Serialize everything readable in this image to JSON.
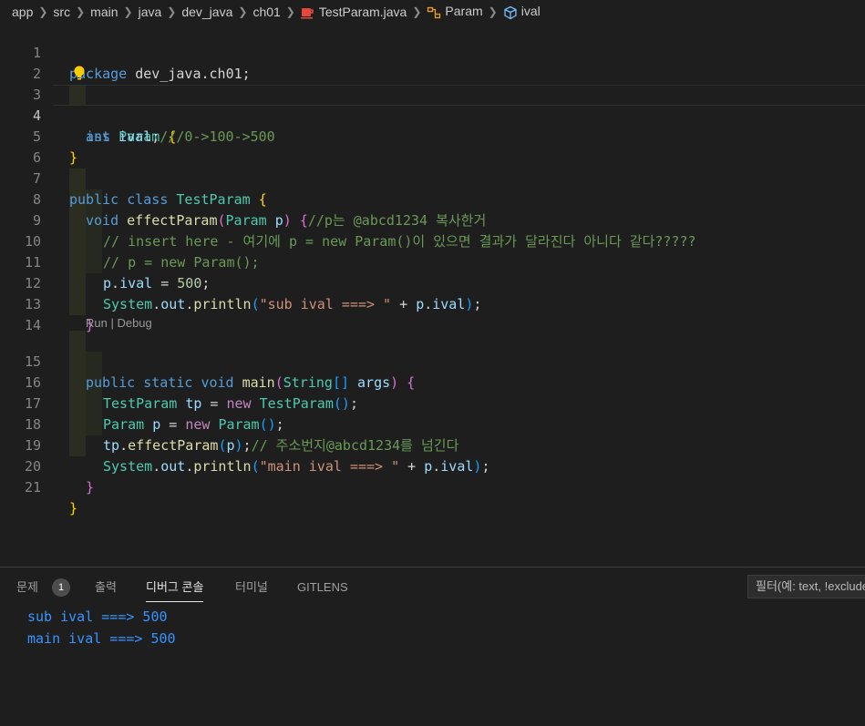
{
  "breadcrumb": {
    "items": [
      "app",
      "src",
      "main",
      "java",
      "dev_java",
      "ch01"
    ],
    "file": "TestParam.java",
    "class_symbol": "Param",
    "field_symbol": "ival"
  },
  "editor": {
    "line_numbers": [
      "1",
      "2",
      "3",
      "4",
      "5",
      "6",
      "7",
      "8",
      "9",
      "10",
      "11",
      "12",
      "13",
      "14",
      "15",
      "16",
      "17",
      "18",
      "19",
      "20",
      "21"
    ],
    "active_line": "4",
    "codelens": "Run | Debug",
    "lines": {
      "l1": [
        "package",
        " dev_java.ch01;"
      ],
      "l3": [
        "ass",
        " ",
        "Param",
        " ",
        "{"
      ],
      "l4": [
        "int",
        " ",
        "ival",
        ";",
        "///0->100->500"
      ],
      "l5": [
        "}"
      ],
      "l7": [
        "public",
        " ",
        "class",
        " ",
        "TestParam",
        " ",
        "{"
      ],
      "l8": [
        "void",
        " ",
        "effectParam",
        "(",
        "Param",
        " ",
        "p",
        ")",
        " ",
        "{",
        "//p는 @abcd1234 복사한거"
      ],
      "l9": [
        "// insert here - 여기에 p = new Param()이 있으면 결과가 달라진다 아니다 같다?????"
      ],
      "l10": [
        "// p = new Param();"
      ],
      "l11": [
        "p",
        ".",
        "ival",
        " = ",
        "500",
        ";"
      ],
      "l12": [
        "System",
        ".",
        "out",
        ".",
        "println",
        "(",
        "\"sub ival ===> \"",
        " + ",
        "p",
        ".",
        "ival",
        ")",
        ";"
      ],
      "l13": [
        "}"
      ],
      "l15": [
        "public",
        " ",
        "static",
        " ",
        "void",
        " ",
        "main",
        "(",
        "String",
        "[]",
        " ",
        "args",
        ")",
        " ",
        "{"
      ],
      "l16": [
        "TestParam",
        " ",
        "tp",
        " = ",
        "new",
        " ",
        "TestParam",
        "()",
        ";"
      ],
      "l17": [
        "Param",
        " ",
        "p",
        " = ",
        "new",
        " ",
        "Param",
        "()",
        ";"
      ],
      "l18": [
        "tp",
        ".",
        "effectParam",
        "(",
        "p",
        ")",
        ";",
        "// 주소번지@abcd1234를 넘긴다"
      ],
      "l19": [
        "System",
        ".",
        "out",
        ".",
        "println",
        "(",
        "\"main ival ===> \"",
        " + ",
        "p",
        ".",
        "ival",
        ")",
        ";"
      ],
      "l20": [
        "}"
      ],
      "l21": [
        "}"
      ]
    }
  },
  "panel": {
    "tabs": {
      "problems": "문제",
      "problems_count": "1",
      "output": "출력",
      "debug_console": "디버그 콘솔",
      "terminal": "터미널",
      "gitlens": "GITLENS"
    },
    "filter_placeholder": "필터(예: text, !exclude)",
    "console_lines": [
      "sub ival ===> 500",
      "main ival ===> 500"
    ]
  },
  "colors": {
    "background": "#1e1e1e",
    "keyword": "#569cd6",
    "control_keyword": "#c586c0",
    "type": "#4ec9b0",
    "function": "#dcdcaa",
    "variable": "#9cdcfe",
    "number": "#b5cea8",
    "string": "#ce9178",
    "comment": "#6a9955",
    "console_text": "#3794ff"
  },
  "icons": {
    "java_file": "java-file-icon",
    "class_symbol": "class-symbol-icon",
    "field_symbol": "field-symbol-icon",
    "lightbulb": "lightbulb-icon"
  }
}
